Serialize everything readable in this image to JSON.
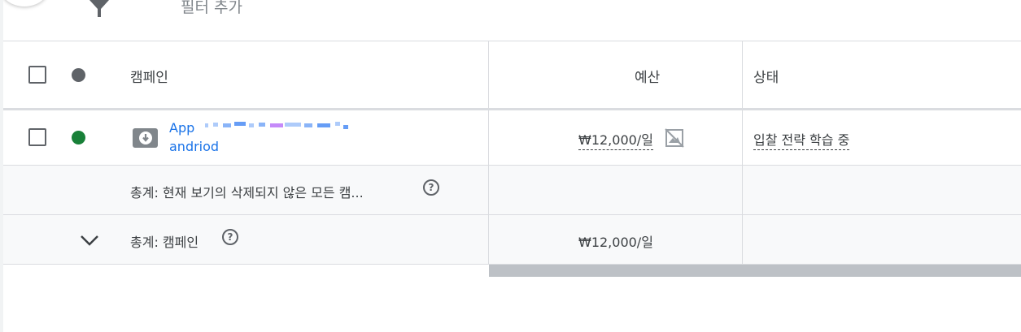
{
  "filter_bar": {
    "icon": "filter-icon",
    "label": "필터 추가"
  },
  "table": {
    "columns": {
      "campaign": "캠페인",
      "budget": "예산",
      "status": "상태"
    },
    "rows": [
      {
        "name_line1": "App",
        "name_line2": "andriod",
        "status_color": "#188038",
        "budget": "₩12,000/일",
        "status": "입찰 전략 학습 중"
      }
    ],
    "totals": {
      "all_label": "총계: 현재 보기의 삭제되지 않은 모든 캠...",
      "campaign_label": "총계: 캠페인",
      "campaign_budget": "₩12,000/일"
    }
  },
  "colors": {
    "link": "#1a73e8",
    "header_dot": "#5f6368"
  }
}
